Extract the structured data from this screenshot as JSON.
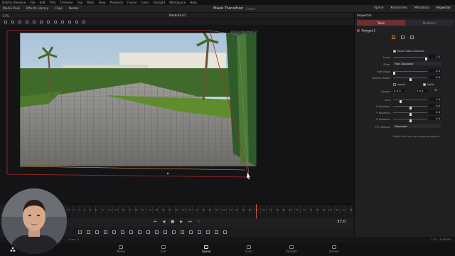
{
  "menu": [
    "DaVinci Resolve",
    "File",
    "Edit",
    "Trim",
    "Timeline",
    "Clip",
    "Mark",
    "View",
    "Playback",
    "Fusion",
    "Color",
    "Fairlight",
    "Workspace",
    "Help"
  ],
  "toolbar": {
    "left": [
      "Media Pool",
      "Effects Library",
      "Clips",
      "Nodes"
    ],
    "title": "Mask Transition",
    "edited": "Edited",
    "right": [
      "Spline",
      "Keyframes",
      "Metadata",
      "Inspector"
    ]
  },
  "viewer": {
    "zoom": "57%",
    "name": "MediaOut1",
    "resolution": "1920x1080xfloat32"
  },
  "inspector": {
    "title": "Inspector",
    "tabs": [
      "Tools",
      "Modifiers"
    ],
    "node": "Polygon1",
    "show_view_controls": "Show View Controls",
    "rows": [
      {
        "label": "Level",
        "value": "1.0",
        "knob": 0.98
      },
      {
        "label": "Filter",
        "dropdown": "Fast Gaussian"
      },
      {
        "label": "Soft Edge",
        "value": "0.0",
        "knob": 0.0
      },
      {
        "label": "Border Width",
        "value": "0.0",
        "knob": 0.5
      },
      {
        "label": "",
        "invert": "Invert",
        "solid": "Solid"
      },
      {
        "label": "Center",
        "x": "X 0.5",
        "y": "Y 0.5"
      },
      {
        "label": "Size",
        "value": "1.0",
        "knob": 0.2
      },
      {
        "label": "X Rotation",
        "value": "0.0",
        "knob": 0.5
      },
      {
        "label": "Y Rotation",
        "value": "0.0",
        "knob": 0.5
      },
      {
        "label": "Z Rotation",
        "value": "0.0",
        "knob": 0.5
      },
      {
        "label": "Fill Method",
        "dropdown": "Alternate"
      }
    ],
    "hint": "Right click here for shape animation"
  },
  "timeline": {
    "ticks": [
      "0",
      "2",
      "4",
      "6",
      "8",
      "10",
      "12",
      "14",
      "16",
      "18",
      "20",
      "22",
      "24",
      "26",
      "28",
      "30",
      "32",
      "34",
      "36",
      "38",
      "40",
      "42",
      "44",
      "46",
      "48",
      "50",
      "52",
      "54",
      "56",
      "58",
      "60",
      "62",
      "64",
      "66",
      "68",
      "70",
      "72",
      "74",
      "76",
      "78",
      "80",
      "82",
      "84",
      "86"
    ]
  },
  "transport": {
    "frame": "37.0"
  },
  "status": {
    "left": "Comp: 0",
    "right": "11% - 3488 MB"
  },
  "pages": [
    "Media",
    "Edit",
    "Fusion",
    "Color",
    "Fairlight",
    "Deliver"
  ],
  "active_page": "Fusion",
  "colors": {
    "accent": "#c64a4a",
    "mask": "#b02a2a",
    "polyline": "#e0a040"
  }
}
